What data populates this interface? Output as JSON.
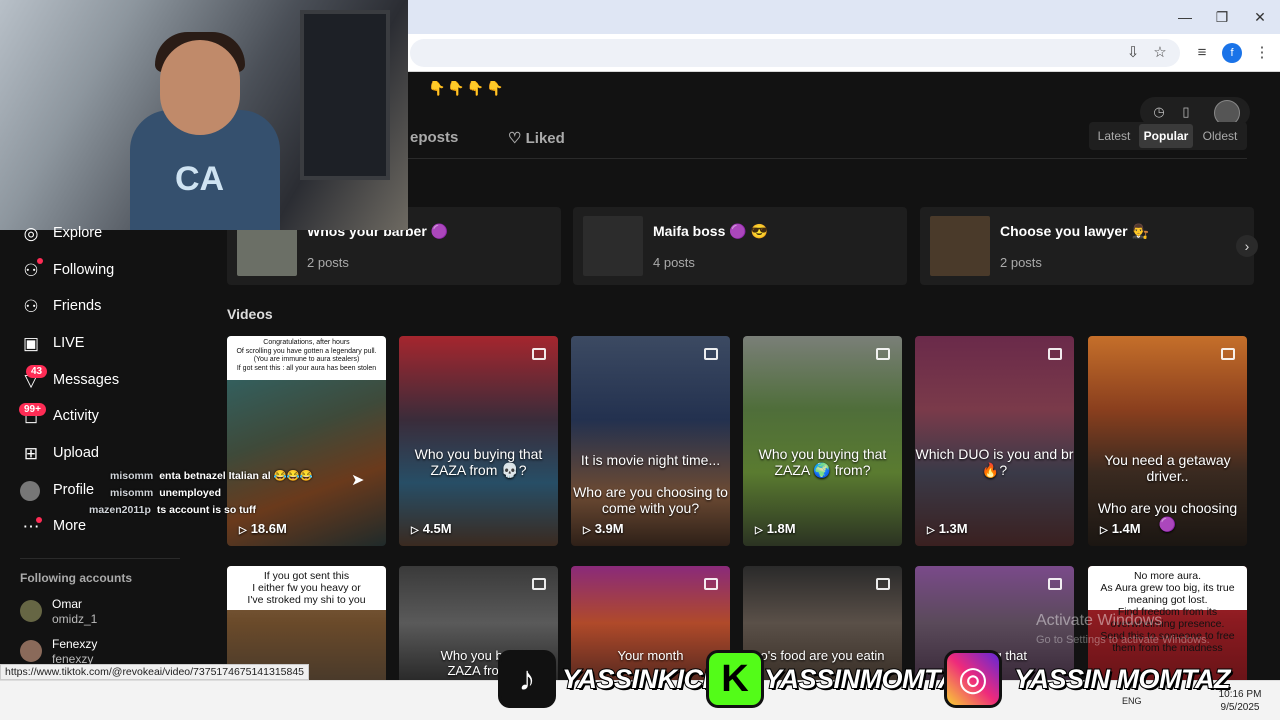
{
  "window": {
    "minimize_glyph": "—",
    "restore_glyph": "❐",
    "close_glyph": "✕"
  },
  "toolbar": {
    "install_glyph": "⇩",
    "star_glyph": "☆",
    "media_glyph": "≡",
    "profile_initial": "f",
    "menu_glyph": "⋮"
  },
  "profile": {
    "emoji_row": "👇👇👇👇"
  },
  "tabs": {
    "reposts": "eposts",
    "liked": "Liked",
    "liked_icon": "♡"
  },
  "tools": {
    "history_icon": "◷",
    "device_icon": "▯"
  },
  "sort": {
    "latest": "Latest",
    "popular": "Popular",
    "oldest": "Oldest",
    "selected": "Popular"
  },
  "collections": [
    {
      "title": "Whos your barber 🟣",
      "count": "2 posts",
      "color": "#6b6f66"
    },
    {
      "title": "Maifa boss 🟣 😎",
      "count": "4 posts",
      "color": "#2c2c2c"
    },
    {
      "title": "Choose you lawyer 👨‍⚖️",
      "count": "2 posts",
      "color": "#4a3a2a"
    }
  ],
  "collections_next": "›",
  "videos_label": "Videos",
  "videos_row1": [
    {
      "caption_box": "Congratulations, after hours\nOf scrolling you have gotten a legendary pull.\n(You are immune to aura stealers)\nIf got sent this : all your aura has been stolen",
      "caption": "",
      "views": "18.6M",
      "bg": "linear-gradient(160deg,#2d6b72 0%,#3e4a3a 45%,#6a3a1c 70%,#1f2a2a 100%)"
    },
    {
      "caption_box": "",
      "caption": "Who you buying that ZAZA from 💀?",
      "views": "4.5M",
      "bg": "linear-gradient(180deg,#a5262e 0%,#3a2c3a 40%,#274e66 70%,#3a2a20 100%)"
    },
    {
      "caption_box": "",
      "caption": "It is movie night time...\n\nWho are you choosing to come with you?",
      "views": "3.9M",
      "bg": "linear-gradient(180deg,#3c4a62 0%,#23314f 40%,#6c4a33 75%,#2e2018 100%)"
    },
    {
      "caption_box": "",
      "caption": "Who you buying that ZAZA 🌍 from?",
      "views": "1.8M",
      "bg": "linear-gradient(180deg,#7a7f78 0%,#4f6e3a 35%,#5a7b30 65%,#2b3322 100%)"
    },
    {
      "caption_box": "",
      "caption": "Which DUO is you and br 🔥?",
      "views": "1.3M",
      "bg": "linear-gradient(180deg,#6a2a4a 0%,#7a3a4a 35%,#3a3a48 65%,#3a2020 100%)"
    },
    {
      "caption_box": "",
      "caption": "You need a getaway driver..\n\nWho are you choosing 🟣",
      "views": "1.4M",
      "bg": "linear-gradient(180deg,#c56f2a 0%,#8a3f1e 35%,#3a2a20 65%,#1b1612 100%)"
    }
  ],
  "videos_row2": [
    {
      "caption_box": "If you got sent this\nI either fw you heavy or\nI've stroked my shi to you",
      "caption": "",
      "bg": "linear-gradient(180deg,#8a6a4a 0%,#6a4a2a 50%,#4a3a2a 100%)"
    },
    {
      "caption_box": "",
      "caption": "Who you buy\nZAZA from",
      "bg": "linear-gradient(180deg,#3a3a3a 0%,#5a5a5a 50%,#2a2a2a 100%)"
    },
    {
      "caption_box": "",
      "caption": "Your month",
      "bg": "linear-gradient(180deg,#8a2a7a 0%,#b04a2a 50%,#5a2a20 100%)"
    },
    {
      "caption_box": "",
      "caption": "o's food are you eatin",
      "bg": "linear-gradient(180deg,#2a2a2a 0%,#5a5048 50%,#3a3028 100%)"
    },
    {
      "caption_box": "",
      "caption": "W           ying that",
      "bg": "linear-gradient(180deg,#7a4a8a 0%,#5a4a5a 50%,#3a2a3a 100%)"
    },
    {
      "caption_box": "No more aura.\nAs Aura grew too big, its true meaning got lost.\nFind freedom from its overwhelming presence.\nSend this to someone to free them from the madness",
      "caption": "",
      "bg": "linear-gradient(180deg,#b02a30 0%,#8a1a20 50%,#6a1418 100%)"
    }
  ],
  "sidebar": {
    "items": [
      {
        "label": "Explore",
        "icon": "◎"
      },
      {
        "label": "Following",
        "icon": "⚇"
      },
      {
        "label": "Friends",
        "icon": "⚇"
      },
      {
        "label": "LIVE",
        "icon": "▣"
      },
      {
        "label": "Messages",
        "icon": "▽",
        "badge": "43"
      },
      {
        "label": "Activity",
        "icon": "◻",
        "badge": "99+"
      },
      {
        "label": "Upload",
        "icon": "⊞"
      },
      {
        "label": "Profile",
        "icon": ""
      },
      {
        "label": "More",
        "icon": "⋯"
      }
    ],
    "following_title": "Following accounts",
    "accounts": [
      {
        "name": "Omar",
        "handle": "omidz_1"
      },
      {
        "name": "Fenexzy",
        "handle": "fenexzy"
      }
    ]
  },
  "chat": [
    {
      "user": "misomm",
      "text": "enta betnazel Italian al 😂😂😂"
    },
    {
      "user": "misomm",
      "text": "unemployed"
    },
    {
      "user": "mazen2011p",
      "text": "ts account is so tuff"
    }
  ],
  "status_url": "https://www.tiktok.com/@revokeai/video/7375174675141315845",
  "social": [
    {
      "label": "YASSINKICK",
      "color": "#111111",
      "glyph": "♪"
    },
    {
      "label": "YASSINMOMTAZ",
      "color": "#53fc18",
      "glyph": "K"
    },
    {
      "label": "YASSIN MOMTAZ",
      "color": "#d62976",
      "glyph": "◎"
    }
  ],
  "watermark": {
    "title": "Activate Windows",
    "sub": "Go to Settings to activate Windows."
  },
  "taskbar": {
    "lang": "ENG",
    "time": "10:16 PM",
    "date": "9/5/2025"
  }
}
